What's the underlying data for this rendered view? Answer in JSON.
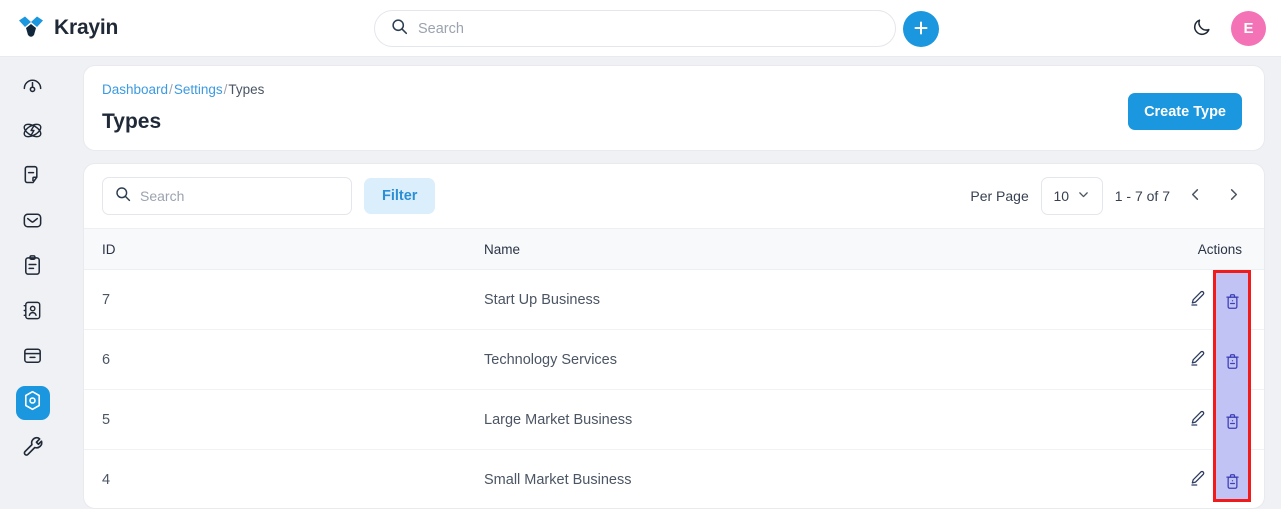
{
  "app": {
    "brand_name": "Krayin",
    "logo_icon": "krayin-diamond-logo",
    "accent_color": "#1a97de",
    "avatar_color": "#f472b6"
  },
  "topbar": {
    "search_placeholder": "Search",
    "search_icon": "search-icon",
    "add_icon": "plus-icon",
    "theme_toggle_icon": "moon-icon",
    "avatar_initial": "E"
  },
  "sidebar": {
    "items": [
      {
        "name": "dashboard",
        "icon": "gauge-icon",
        "active": false
      },
      {
        "name": "leads",
        "icon": "atom-spiral-icon",
        "active": false
      },
      {
        "name": "quotes",
        "icon": "document-icon",
        "active": false
      },
      {
        "name": "mail",
        "icon": "envelope-icon",
        "active": false
      },
      {
        "name": "activities",
        "icon": "clipboard-icon",
        "active": false
      },
      {
        "name": "contacts",
        "icon": "contact-card-icon",
        "active": false
      },
      {
        "name": "products",
        "icon": "box-icon",
        "active": false
      },
      {
        "name": "settings",
        "icon": "hexagon-target-icon",
        "active": true
      },
      {
        "name": "configuration",
        "icon": "wrench-icon",
        "active": false
      }
    ]
  },
  "header_card": {
    "breadcrumb": {
      "dashboard": "Dashboard",
      "settings": "Settings",
      "current": "Types",
      "separator": "/"
    },
    "page_title": "Types",
    "create_button": "Create Type"
  },
  "toolbar": {
    "search_placeholder": "Search",
    "search_icon": "search-icon",
    "filter_label": "Filter",
    "per_page_label": "Per Page",
    "per_page_value": "10",
    "per_page_chevron": "chevron-down-icon",
    "range_label": "1 - 7 of 7",
    "prev_icon": "chevron-left-icon",
    "next_icon": "chevron-right-icon"
  },
  "table": {
    "columns": {
      "id": "ID",
      "name": "Name",
      "actions": "Actions"
    },
    "row_action_icons": {
      "edit": "pencil-icon",
      "delete": "trash-icon"
    },
    "rows": [
      {
        "id": "7",
        "name": "Start Up Business"
      },
      {
        "id": "6",
        "name": "Technology Services"
      },
      {
        "id": "5",
        "name": "Large Market Business"
      },
      {
        "id": "4",
        "name": "Small Market Business"
      }
    ]
  },
  "annotation": {
    "highlight_color": "#c2c3f5",
    "box_color": "#f21b1b",
    "target": "delete-action-column"
  }
}
